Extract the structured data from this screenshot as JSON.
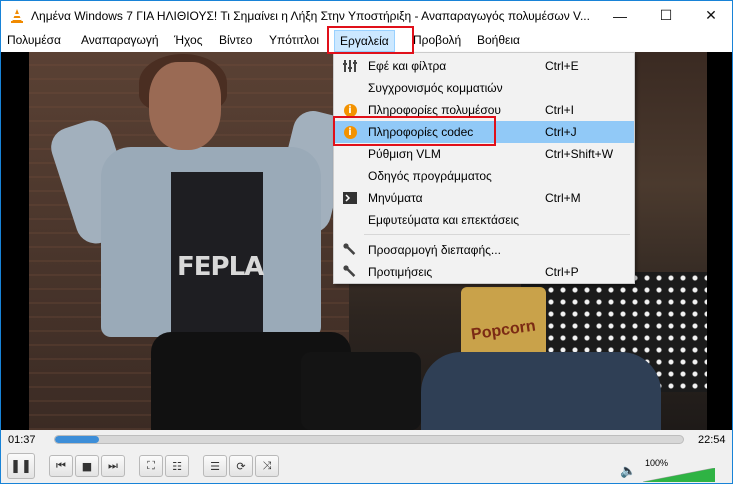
{
  "window": {
    "title": "Λημένα Windows 7 ΓΙΑ ΗΛΙΘΙΟΥΣ! Τι Σημαίνει η Λήξη Στην Υποστήριξη - Αναπαραγωγός πολυμέσων V...",
    "minimize": "—",
    "maximize": "☐",
    "close": "✕"
  },
  "menubar": {
    "items": [
      "Πολυμέσα",
      "Αναπαραγωγή",
      "Ήχος",
      "Βίντεο",
      "Υπότιτλοι",
      "Εργαλεία",
      "Προβολή",
      "Βοήθεια"
    ],
    "active": "Εργαλεία"
  },
  "video": {
    "shirt_text": "FEPLA",
    "popcorn_text": "Popcorn"
  },
  "tools_menu": {
    "items": [
      {
        "label": "Εφέ και φίλτρα",
        "shortcut": "Ctrl+E",
        "icon": "equalizer-icon"
      },
      {
        "label": "Συγχρονισμός κομματιών",
        "shortcut": "",
        "icon": ""
      },
      {
        "label": "Πληροφορίες πολυμέσου",
        "shortcut": "Ctrl+I",
        "icon": "info-icon"
      },
      {
        "label": "Πληροφορίες codec",
        "shortcut": "Ctrl+J",
        "icon": "info-icon"
      },
      {
        "label": "Ρύθμιση VLM",
        "shortcut": "Ctrl+Shift+W",
        "icon": ""
      },
      {
        "label": "Οδηγός προγράμματος",
        "shortcut": "",
        "icon": ""
      },
      {
        "label": "Μηνύματα",
        "shortcut": "Ctrl+M",
        "icon": "terminal-icon"
      },
      {
        "label": "Εμφυτεύματα και επεκτάσεις",
        "shortcut": "",
        "icon": ""
      },
      {
        "label": "Προσαρμογή διεπαφής...",
        "shortcut": "",
        "icon": "wrench-icon"
      },
      {
        "label": "Προτιμήσεις",
        "shortcut": "Ctrl+P",
        "icon": "wrench-icon"
      }
    ],
    "highlighted": "Πληροφορίες codec",
    "info_glyph": "i"
  },
  "playback": {
    "current_time": "01:37",
    "total_time": "22:54",
    "progress": 0.07,
    "volume_label": "100%",
    "volume": 1.0
  },
  "controls": {
    "pause": "❚❚",
    "prev": "⏮",
    "stop": "■",
    "next": "⏭",
    "fullscreen": "⛶",
    "extended": "☷",
    "playlist": "☰",
    "loop": "⟳",
    "shuffle": "⤨",
    "speaker": "🔈"
  },
  "colors": {
    "accent": "#1883d7",
    "highlight": "#91c9f7",
    "menu_active_bg": "#cce8ff",
    "annotation_red": "#e0101a",
    "seek_fill": "#3d8ed8",
    "volume_green": "#2fb344",
    "info_orange": "#f39200"
  }
}
